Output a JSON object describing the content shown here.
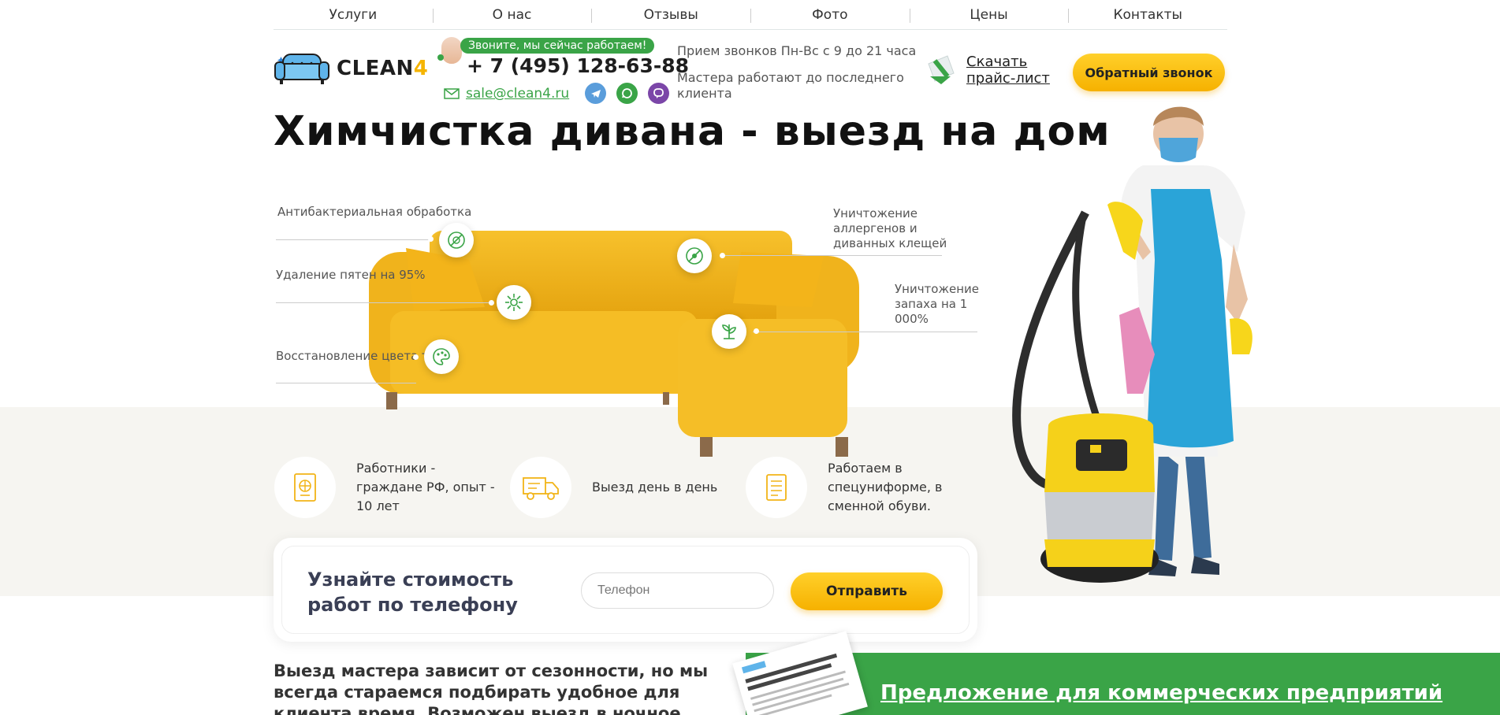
{
  "nav": {
    "items": [
      "Услуги",
      "О нас",
      "Отзывы",
      "Фото",
      "Цены",
      "Контакты"
    ]
  },
  "header": {
    "logo_text": "CLEAN",
    "logo_num": "4",
    "call_badge": "Звоните, мы сейчас работаем!",
    "phone": "+ 7 (495) 128-63-88",
    "email": "sale@clean4.ru",
    "hours": "Прием звонков Пн-Вс с 9 до 21 часа",
    "masters": "Мастера работают до последнего клиента",
    "download": "Скачать прайс-лист",
    "callback": "Обратный звонок"
  },
  "hero": {
    "title": "Химчистка дивана - выезд на дом"
  },
  "features": {
    "antibacterial": "Антибактериальная обработка",
    "stains": "Удаление пятен на 95%",
    "color": "Восстановление цвета ткани",
    "allergens": "Уничтожение аллергенов и диванных клещей",
    "odor": "Уничтожение запаха на 1 000%"
  },
  "perks": {
    "workers": "Работники - граждане РФ, опыт - 10 лет",
    "same_day": "Выезд день в день",
    "uniform": "Работаем в спецуниформе, в сменной обуви."
  },
  "price_form": {
    "title": "Узнайте стоимость работ по телефону",
    "placeholder": "Телефон",
    "submit": "Отправить"
  },
  "bottom": {
    "text": "Выезд мастера зависит от сезонности, но мы всегда стараемся подбирать удобное для клиента время. Возможен выезд в ночное время",
    "offer": "Предложение для коммерческих предприятий"
  },
  "colors": {
    "accent_green": "#3aa447",
    "accent_yellow": "#f6b100",
    "sofa": "#f2b417"
  }
}
